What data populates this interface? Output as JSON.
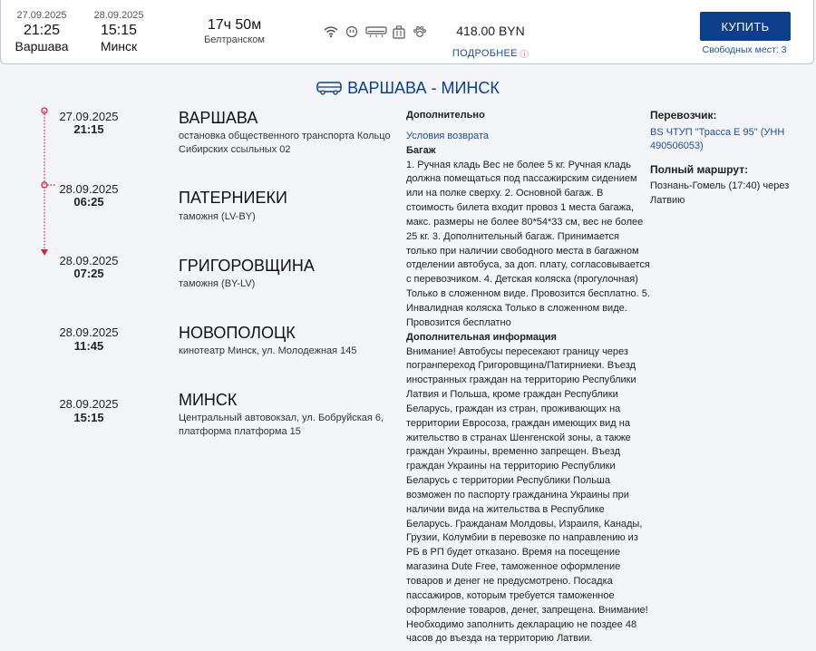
{
  "trip": {
    "departure": {
      "date": "27.09.2025",
      "time": "21:25",
      "city": "Варшава"
    },
    "arrival": {
      "date": "28.09.2025",
      "time": "15:15",
      "city": "Минск"
    },
    "duration": "17ч 50м",
    "company": "Белтранском",
    "amenities": [
      "wifi-icon",
      "socket-icon",
      "air-conditioner-icon",
      "luggage-icon",
      "pet-icon"
    ],
    "price": "418.00 BYN",
    "more_label": "ПОДРОБНЕЕ",
    "buy_label": "КУПИТЬ",
    "seats_label": "Свободных мест: 3"
  },
  "route_title": "ВАРШАВА - МИНСК",
  "stops": [
    {
      "date": "27.09.2025",
      "time": "21:15",
      "name": "ВАРШАВА",
      "address": "остановка общественного транспорта Кольцо Сибирских ссыльных 02"
    },
    {
      "date": "28.09.2025",
      "time": "06:25",
      "name": "ПАТЕРНИЕКИ",
      "address": "таможня (LV-BY)"
    },
    {
      "date": "28.09.2025",
      "time": "07:25",
      "name": "ГРИГОРОВЩИНА",
      "address": "таможня (BY-LV)"
    },
    {
      "date": "28.09.2025",
      "time": "11:45",
      "name": "НОВОПОЛОЦК",
      "address": "кинотеатр Минск, ул. Молодежная 145"
    },
    {
      "date": "28.09.2025",
      "time": "15:15",
      "name": "МИНСК",
      "address": "Центральный автовокзал, ул. Бобруйская 6, платформа платформа 15"
    }
  ],
  "info": {
    "heading": "Дополнительно",
    "refund_link": "Условия возврата",
    "baggage_heading": "Багаж",
    "baggage_text": "1. Ручная кладь Вес не более 5 кг. Ручная кладь должна помещаться под пассажирским сидением или на полке сверху. 2. Основной багаж. В стоимость билета входит провоз 1 места багажа, макс. размеры не более 80*54*33 см, вес не более 25 кг. 3. Дополнительный багаж. Принимается только при наличии свободного места в багажном отделении автобуса, за доп. плату, согласовывается с перевозчиком. 4. Детская коляска (прогулочная) Только в сложенном виде. Провозится бесплатно. 5. Инвалидная коляска Только в сложенном виде. Провозится бесплатно",
    "extra_heading": "Дополнительная информация",
    "extra_text": "Внимание! Автобусы пересекают границу через погранпереход Григоровщина/Патирниеки. Въезд иностранных граждан на территорию Республики Латвия и Польша, кроме граждан Республики Беларусь, граждан из стран, проживающих на территории Евросоза, граждан имеющих вид на жительство в странах Шенгенской зоны, а также граждан Украины, временно запрещен. Въезд граждан Украины на территорию Республики Беларусь с территории Республики Польша возможен по паспорту гражданина Украины при наличии вида на жительства в Республике Беларусь. Гражданам Молдовы, Израиля, Канады, Грузии, Колумбии в перевозке по направлению из РБ в РП будет отказано. Время на посещение магазина Dute Free, таможенное оформление товаров и денег не предусмотрено. Посадка пассажиров, которым требуется таможенное оформление товаров, денег, запрещена. Внимание! Необходимо заполнить декларацию не поздее 48 часов до въезда на территорию Латвии."
  },
  "carrier": {
    "heading": "Перевозчик:",
    "name": "BS ЧТУП \"Трасса Е 95\" (УНН 490506053)",
    "route_heading": "Полный маршрут:",
    "route": "Познань-Гомель (17:40) через Латвию"
  },
  "colors": {
    "accent": "#0d3e88",
    "link": "#1f4fa0",
    "timeline": "#e0203a"
  }
}
